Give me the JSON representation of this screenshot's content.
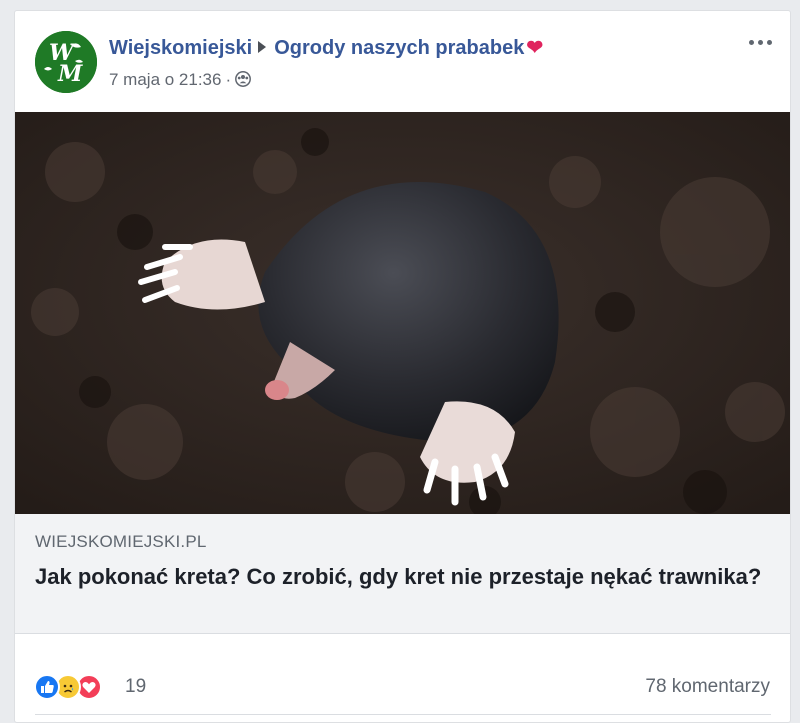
{
  "post": {
    "page_name": "Wiejskomiejski",
    "group_name": "Ogrody naszych prababek",
    "heart_emoji": "❤",
    "timestamp": "7 maja o 21:36",
    "separator_dot": "·",
    "avatar_text": "WM",
    "audience_icon": "group-audience-icon",
    "more_icon": "more-options-icon"
  },
  "link_preview": {
    "image_icon": "mole-in-soil-photo",
    "domain": "WIEJSKOMIEJSKI.PL",
    "title": "Jak pokonać kreta? Co zrobić, gdy kret nie przestaje nękać trawnika?"
  },
  "engagement": {
    "reactions": [
      "like",
      "sad",
      "love"
    ],
    "reaction_count": "19",
    "comments": "78 komentarzy"
  },
  "colors": {
    "link": "#385898",
    "muted": "#606770",
    "like": "#1877f2",
    "sad": "#f7c935",
    "love": "#f33e58",
    "avatar": "#1f7a26"
  }
}
